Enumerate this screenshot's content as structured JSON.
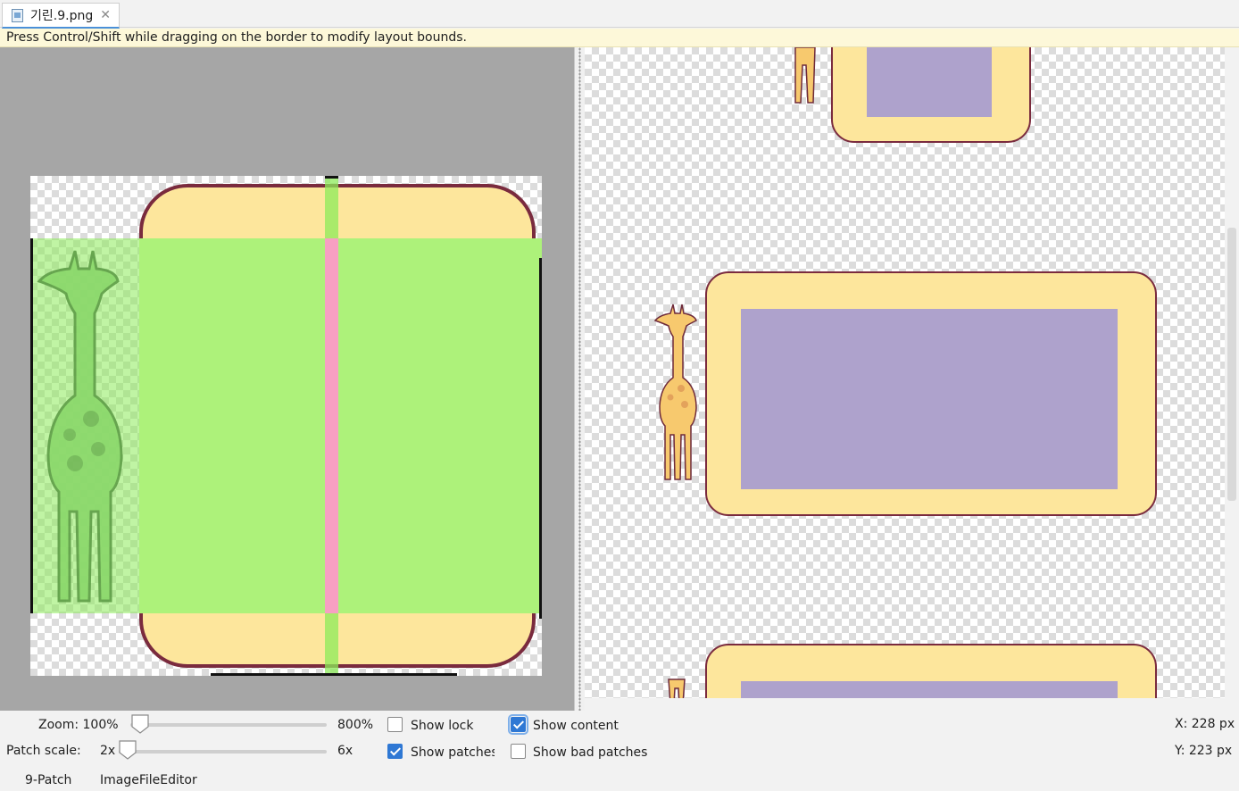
{
  "tab": {
    "icon": "file-icon",
    "title": "기린.9.png",
    "close_glyph": "✕"
  },
  "hint": "Press Control/Shift while dragging on the border to modify layout bounds.",
  "controls": {
    "zoom_label": "Zoom: 100%",
    "zoom_max": "800%",
    "patch_scale_label": "Patch scale:",
    "patch_scale_min": "2x",
    "patch_scale_max": "6x",
    "show_lock": {
      "label": "Show lock",
      "checked": false
    },
    "show_patches": {
      "label": "Show patches",
      "checked": true
    },
    "show_content": {
      "label": "Show content",
      "checked": true
    },
    "show_bad_patches": {
      "label": "Show bad patches",
      "checked": false
    },
    "x_readout": "X: 228 px",
    "y_readout": "Y: 223 px"
  },
  "bottom_tabs": [
    "9-Patch",
    "ImageFileEditor"
  ],
  "colors": {
    "card_fill": "#fde69c",
    "card_border": "#7a2b3e",
    "content_fill": "#aea2cc",
    "patch_green": "#adf27a",
    "patch_pink": "#f7a0c2"
  }
}
